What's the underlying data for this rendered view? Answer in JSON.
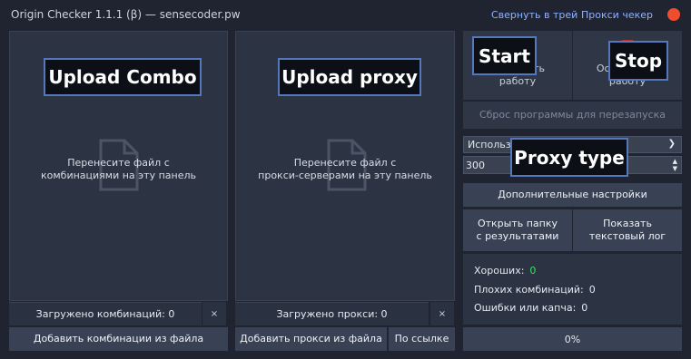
{
  "window": {
    "title": "Origin Checker 1.1.1 (β) — sensecoder.pw",
    "minimize_tray": "Свернуть в трей",
    "proxy_checker": "Прокси чекер"
  },
  "combo_panel": {
    "overlay": "Upload Combo",
    "hint_line1": "Перенесите файл с",
    "hint_line2": "комбинациями на эту панель",
    "loaded": "Загружено комбинаций: 0",
    "clear": "×",
    "add_button": "Добавить комбинации из файла"
  },
  "proxy_panel": {
    "overlay": "Upload proxy",
    "hint_line1": "Перенесите файл с",
    "hint_line2": "прокси-серверами на эту панель",
    "loaded": "Загружено прокси: 0",
    "clear": "×",
    "add_button": "Добавить прокси из файла",
    "by_link": "По ссылке"
  },
  "controls": {
    "start_overlay": "Start",
    "start_line1": "Запустить",
    "start_line2": "работу",
    "stop_overlay": "Stop",
    "stop_line1": "Остановить",
    "stop_line2": "работу",
    "reset": "Сброс программы для перезапуска",
    "proxy_type_value": "Использовать HTTPS-прокси",
    "proxy_type_overlay": "Proxy type",
    "threads": "300",
    "extra_settings": "Дополнительные настройки",
    "open_folder_line1": "Открыть папку",
    "open_folder_line2": "с результатами",
    "show_log_line1": "Показать",
    "show_log_line2": "текстовый лог"
  },
  "stats": {
    "good_label": "Хороших:",
    "good_value": "0",
    "bad_label": "Плохих комбинаций:",
    "bad_value": "0",
    "errors_label": "Ошибки или капча:",
    "errors_value": "0"
  },
  "progress": {
    "value": "0%"
  },
  "colors": {
    "accent": "#5577bb",
    "close": "#ee4d2e",
    "good": "#3ee05a"
  }
}
